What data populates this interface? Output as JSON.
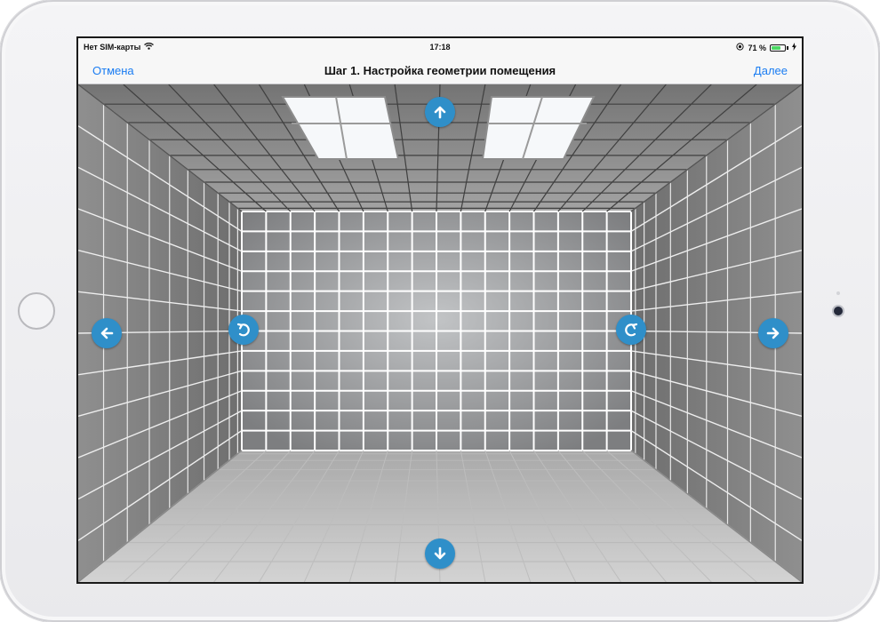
{
  "status_bar": {
    "carrier": "Нет SIM-карты",
    "time": "17:18",
    "battery": "71 %",
    "battery_level": 0.71
  },
  "nav_bar": {
    "cancel_label": "Отмена",
    "title": "Шаг 1. Настройка геометрии помещения",
    "next_label": "Далее"
  },
  "controls": {
    "up_icon": "arrow-up-icon",
    "down_icon": "arrow-down-icon",
    "left_icon": "arrow-left-icon",
    "right_icon": "arrow-right-icon",
    "rotate_left_icon": "rotate-ccw-icon",
    "rotate_right_icon": "rotate-cw-icon"
  },
  "colors": {
    "accent": "#1a7cf2",
    "control_button": "#2f8fc9",
    "battery_fill": "#4cd964"
  }
}
